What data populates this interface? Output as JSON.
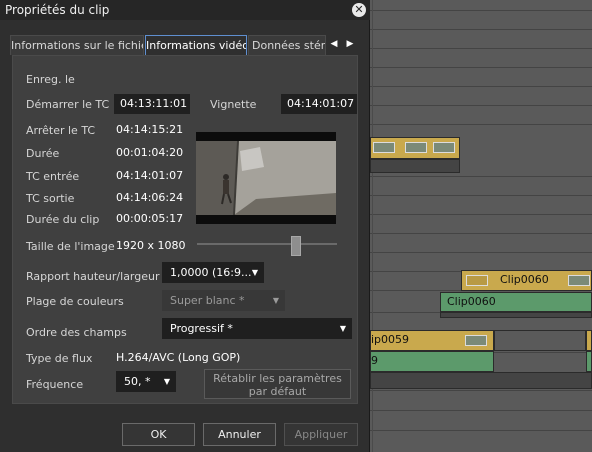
{
  "dialog": {
    "title": "Propriétés du clip",
    "tabs": [
      {
        "label": "Informations sur le fichier",
        "active": false
      },
      {
        "label": "Informations vidéo",
        "active": true
      },
      {
        "label": "Données stéréo",
        "active": false
      }
    ]
  },
  "info": {
    "enreg_label": "Enreg. le",
    "start_tc_label": "Démarrer le TC",
    "start_tc_value": "04:13:11:01",
    "thumbnail_label": "Vignette",
    "thumbnail_value": "04:14:01:07",
    "stop_tc_label": "Arrêter le TC",
    "stop_tc_value": "04:14:15:21",
    "duration_label": "Durée",
    "duration_value": "00:01:04:20",
    "tc_in_label": "TC entrée",
    "tc_in_value": "04:14:01:07",
    "tc_out_label": "TC sortie",
    "tc_out_value": "04:14:06:24",
    "clip_duration_label": "Durée du clip",
    "clip_duration_value": "00:00:05:17",
    "image_size_label": "Taille de l'image",
    "image_size_value": "1920 x 1080",
    "aspect_label": "Rapport hauteur/largeur",
    "aspect_value": "1,0000 (16:9...",
    "color_range_label": "Plage de couleurs",
    "color_range_value": "Super blanc *",
    "field_order_label": "Ordre des champs",
    "field_order_value": "Progressif *",
    "stream_type_label": "Type de flux",
    "stream_type_value": "H.264/AVC (Long GOP)",
    "frequency_label": "Fréquence",
    "frequency_value": "50, *",
    "reset_button": "Rétablir les paramètres par défaut"
  },
  "preview": {
    "slider_position": 0.71
  },
  "buttons": {
    "ok": "OK",
    "cancel": "Annuler",
    "apply": "Appliquer"
  },
  "timeline": {
    "clips": [
      {
        "label": "Clip0060",
        "kind": "video"
      },
      {
        "label": "Clip0060",
        "kind": "audio"
      },
      {
        "label": "ip0059",
        "kind": "video"
      },
      {
        "label": "9",
        "kind": "audio"
      }
    ]
  },
  "colors": {
    "video_clip": "#c9a94d",
    "audio_clip": "#5c9a6b",
    "active_tab_border": "#5f8fd0"
  },
  "icons": [
    "close-icon",
    "arrow-left-icon",
    "arrow-right-icon",
    "dropdown-arrow-icon"
  ]
}
